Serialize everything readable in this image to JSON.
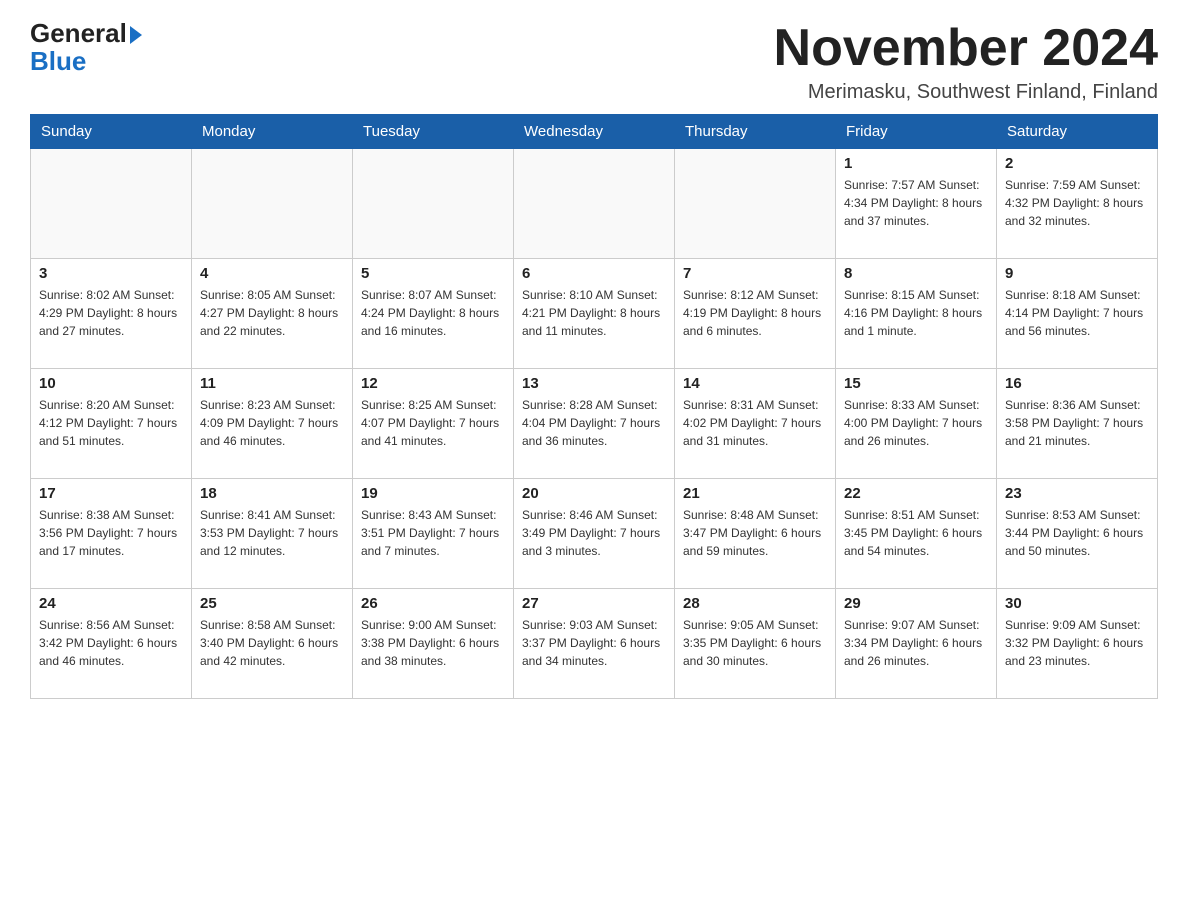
{
  "header": {
    "logo_line1": "General",
    "logo_line2": "Blue",
    "main_title": "November 2024",
    "subtitle": "Merimasku, Southwest Finland, Finland"
  },
  "days_of_week": [
    "Sunday",
    "Monday",
    "Tuesday",
    "Wednesday",
    "Thursday",
    "Friday",
    "Saturday"
  ],
  "weeks": [
    [
      {
        "day": "",
        "info": ""
      },
      {
        "day": "",
        "info": ""
      },
      {
        "day": "",
        "info": ""
      },
      {
        "day": "",
        "info": ""
      },
      {
        "day": "",
        "info": ""
      },
      {
        "day": "1",
        "info": "Sunrise: 7:57 AM\nSunset: 4:34 PM\nDaylight: 8 hours\nand 37 minutes."
      },
      {
        "day": "2",
        "info": "Sunrise: 7:59 AM\nSunset: 4:32 PM\nDaylight: 8 hours\nand 32 minutes."
      }
    ],
    [
      {
        "day": "3",
        "info": "Sunrise: 8:02 AM\nSunset: 4:29 PM\nDaylight: 8 hours\nand 27 minutes."
      },
      {
        "day": "4",
        "info": "Sunrise: 8:05 AM\nSunset: 4:27 PM\nDaylight: 8 hours\nand 22 minutes."
      },
      {
        "day": "5",
        "info": "Sunrise: 8:07 AM\nSunset: 4:24 PM\nDaylight: 8 hours\nand 16 minutes."
      },
      {
        "day": "6",
        "info": "Sunrise: 8:10 AM\nSunset: 4:21 PM\nDaylight: 8 hours\nand 11 minutes."
      },
      {
        "day": "7",
        "info": "Sunrise: 8:12 AM\nSunset: 4:19 PM\nDaylight: 8 hours\nand 6 minutes."
      },
      {
        "day": "8",
        "info": "Sunrise: 8:15 AM\nSunset: 4:16 PM\nDaylight: 8 hours\nand 1 minute."
      },
      {
        "day": "9",
        "info": "Sunrise: 8:18 AM\nSunset: 4:14 PM\nDaylight: 7 hours\nand 56 minutes."
      }
    ],
    [
      {
        "day": "10",
        "info": "Sunrise: 8:20 AM\nSunset: 4:12 PM\nDaylight: 7 hours\nand 51 minutes."
      },
      {
        "day": "11",
        "info": "Sunrise: 8:23 AM\nSunset: 4:09 PM\nDaylight: 7 hours\nand 46 minutes."
      },
      {
        "day": "12",
        "info": "Sunrise: 8:25 AM\nSunset: 4:07 PM\nDaylight: 7 hours\nand 41 minutes."
      },
      {
        "day": "13",
        "info": "Sunrise: 8:28 AM\nSunset: 4:04 PM\nDaylight: 7 hours\nand 36 minutes."
      },
      {
        "day": "14",
        "info": "Sunrise: 8:31 AM\nSunset: 4:02 PM\nDaylight: 7 hours\nand 31 minutes."
      },
      {
        "day": "15",
        "info": "Sunrise: 8:33 AM\nSunset: 4:00 PM\nDaylight: 7 hours\nand 26 minutes."
      },
      {
        "day": "16",
        "info": "Sunrise: 8:36 AM\nSunset: 3:58 PM\nDaylight: 7 hours\nand 21 minutes."
      }
    ],
    [
      {
        "day": "17",
        "info": "Sunrise: 8:38 AM\nSunset: 3:56 PM\nDaylight: 7 hours\nand 17 minutes."
      },
      {
        "day": "18",
        "info": "Sunrise: 8:41 AM\nSunset: 3:53 PM\nDaylight: 7 hours\nand 12 minutes."
      },
      {
        "day": "19",
        "info": "Sunrise: 8:43 AM\nSunset: 3:51 PM\nDaylight: 7 hours\nand 7 minutes."
      },
      {
        "day": "20",
        "info": "Sunrise: 8:46 AM\nSunset: 3:49 PM\nDaylight: 7 hours\nand 3 minutes."
      },
      {
        "day": "21",
        "info": "Sunrise: 8:48 AM\nSunset: 3:47 PM\nDaylight: 6 hours\nand 59 minutes."
      },
      {
        "day": "22",
        "info": "Sunrise: 8:51 AM\nSunset: 3:45 PM\nDaylight: 6 hours\nand 54 minutes."
      },
      {
        "day": "23",
        "info": "Sunrise: 8:53 AM\nSunset: 3:44 PM\nDaylight: 6 hours\nand 50 minutes."
      }
    ],
    [
      {
        "day": "24",
        "info": "Sunrise: 8:56 AM\nSunset: 3:42 PM\nDaylight: 6 hours\nand 46 minutes."
      },
      {
        "day": "25",
        "info": "Sunrise: 8:58 AM\nSunset: 3:40 PM\nDaylight: 6 hours\nand 42 minutes."
      },
      {
        "day": "26",
        "info": "Sunrise: 9:00 AM\nSunset: 3:38 PM\nDaylight: 6 hours\nand 38 minutes."
      },
      {
        "day": "27",
        "info": "Sunrise: 9:03 AM\nSunset: 3:37 PM\nDaylight: 6 hours\nand 34 minutes."
      },
      {
        "day": "28",
        "info": "Sunrise: 9:05 AM\nSunset: 3:35 PM\nDaylight: 6 hours\nand 30 minutes."
      },
      {
        "day": "29",
        "info": "Sunrise: 9:07 AM\nSunset: 3:34 PM\nDaylight: 6 hours\nand 26 minutes."
      },
      {
        "day": "30",
        "info": "Sunrise: 9:09 AM\nSunset: 3:32 PM\nDaylight: 6 hours\nand 23 minutes."
      }
    ]
  ]
}
